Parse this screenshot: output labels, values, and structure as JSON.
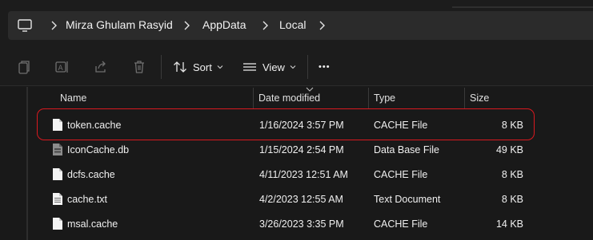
{
  "address": {
    "crumbs": [
      "Mirza Ghulam Rasyid",
      "AppData",
      "Local"
    ]
  },
  "toolbar": {
    "sort_label": "Sort",
    "view_label": "View",
    "more_label": "•••"
  },
  "columns": {
    "name": "Name",
    "date": "Date modified",
    "type": "Type",
    "size": "Size"
  },
  "files": [
    {
      "name": "token.cache",
      "date": "1/16/2024 3:57 PM",
      "type": "CACHE File",
      "size": "8 KB",
      "icon": "file-icon"
    },
    {
      "name": "IconCache.db",
      "date": "1/15/2024 2:54 PM",
      "type": "Data Base File",
      "size": "49 KB",
      "icon": "database-file-icon"
    },
    {
      "name": "dcfs.cache",
      "date": "4/11/2023 12:51 AM",
      "type": "CACHE File",
      "size": "8 KB",
      "icon": "file-icon"
    },
    {
      "name": "cache.txt",
      "date": "4/2/2023 12:55 AM",
      "type": "Text Document",
      "size": "8 KB",
      "icon": "text-file-icon"
    },
    {
      "name": "msal.cache",
      "date": "3/26/2023 3:35 PM",
      "type": "CACHE File",
      "size": "14 KB",
      "icon": "file-icon"
    }
  ],
  "highlight_color": "#d9191f"
}
